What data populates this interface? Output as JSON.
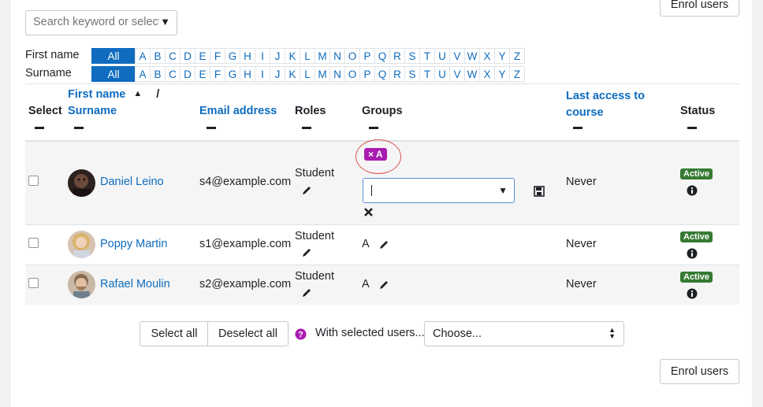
{
  "search": {
    "placeholder": "Search keyword or select filter"
  },
  "top_button": {
    "label": "Enrol users"
  },
  "filters": {
    "firstname_label": "First name",
    "surname_label": "Surname",
    "all_label": "All",
    "letters": [
      "A",
      "B",
      "C",
      "D",
      "E",
      "F",
      "G",
      "H",
      "I",
      "J",
      "K",
      "L",
      "M",
      "N",
      "O",
      "P",
      "Q",
      "R",
      "S",
      "T",
      "U",
      "V",
      "W",
      "X",
      "Y",
      "Z"
    ]
  },
  "table": {
    "headers": {
      "select": "Select",
      "first_name": "First name",
      "sort_arrow": "▲",
      "slash": "/",
      "surname": "Surname",
      "email": "Email address",
      "roles": "Roles",
      "groups": "Groups",
      "last_access": "Last access to course",
      "status": "Status"
    },
    "rows": [
      {
        "name": "Daniel Leino",
        "email": "s4@example.com",
        "role": "Student",
        "group": "A",
        "group_chip": "× A",
        "last_access": "Never",
        "status": "Active"
      },
      {
        "name": "Poppy Martin",
        "email": "s1@example.com",
        "role": "Student",
        "group": "A",
        "last_access": "Never",
        "status": "Active"
      },
      {
        "name": "Rafael Moulin",
        "email": "s2@example.com",
        "role": "Student",
        "group": "A",
        "last_access": "Never",
        "status": "Active"
      }
    ]
  },
  "bulk": {
    "select_all": "Select all",
    "deselect_all": "Deselect all",
    "with_selected": "With selected users...",
    "choose": "Choose..."
  },
  "bottom_button": {
    "label": "Enrol users"
  },
  "colors": {
    "link": "#0f6cbf",
    "active_badge": "#357a32",
    "chip": "#a81cb1",
    "highlight_ring": "#d9534f"
  }
}
